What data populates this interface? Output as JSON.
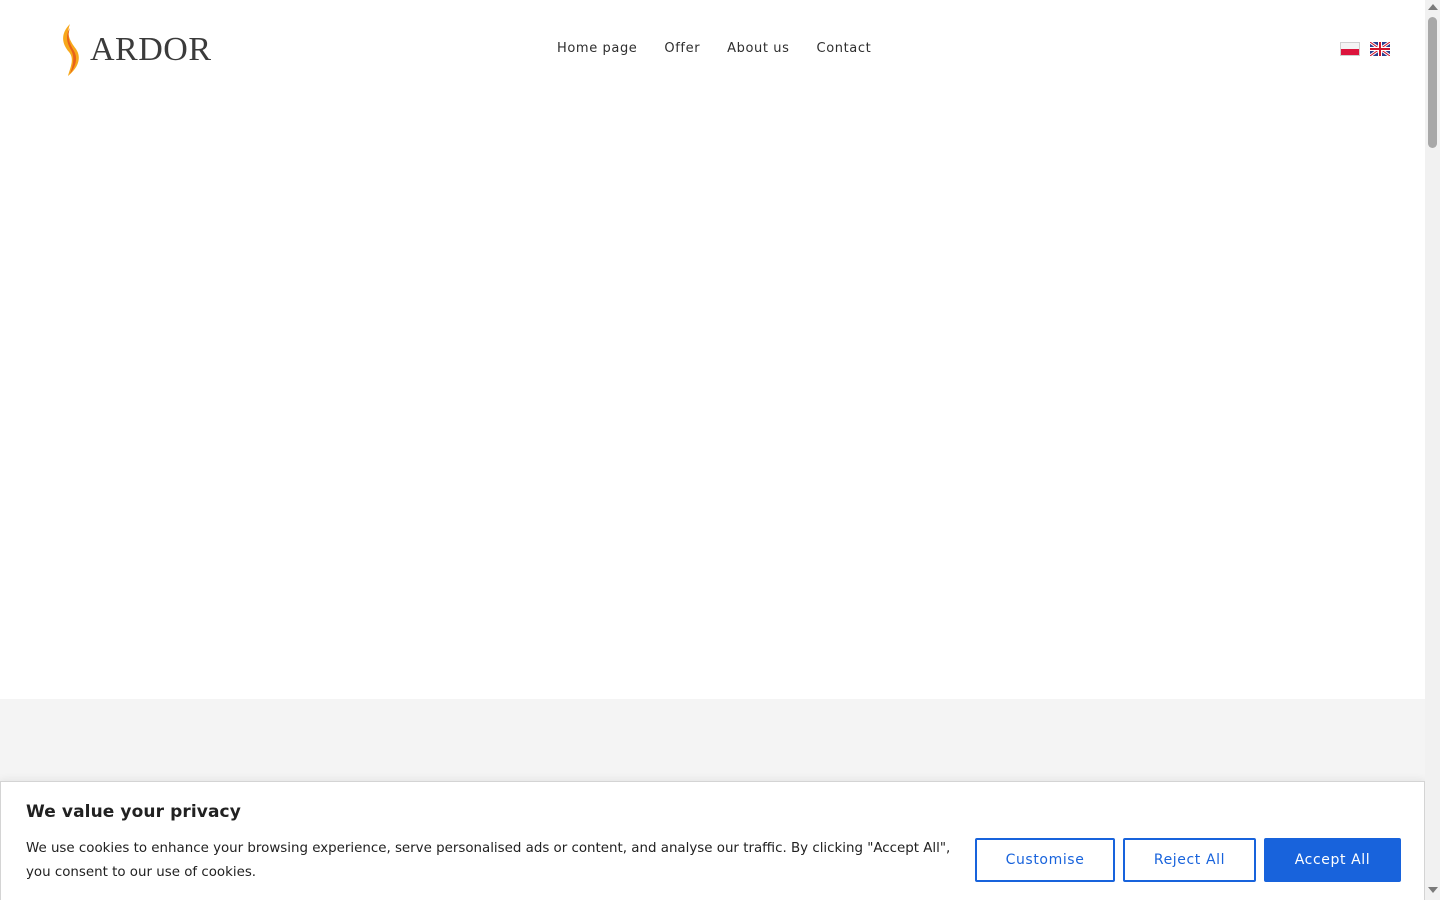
{
  "brand": {
    "name": "ARDOR",
    "flame_colors": [
      "#f7a81b",
      "#e8621b"
    ]
  },
  "nav": {
    "items": [
      {
        "label": "Home page"
      },
      {
        "label": "Offer"
      },
      {
        "label": "About us"
      },
      {
        "label": "Contact"
      }
    ]
  },
  "languages": [
    {
      "icon": "poland-flag-icon"
    },
    {
      "icon": "uk-flag-icon"
    }
  ],
  "cookie_banner": {
    "title": "We value your privacy",
    "text": "We use cookies to enhance your browsing experience, serve personalised ads or content, and analyse our traffic. By clicking \"Accept All\", you consent to our use of cookies.",
    "buttons": {
      "customise": "Customise",
      "reject": "Reject All",
      "accept": "Accept All"
    },
    "accent_color": "#1863dc"
  },
  "colors": {
    "band": "#f4f4f4",
    "text": "#2e2e2e"
  }
}
